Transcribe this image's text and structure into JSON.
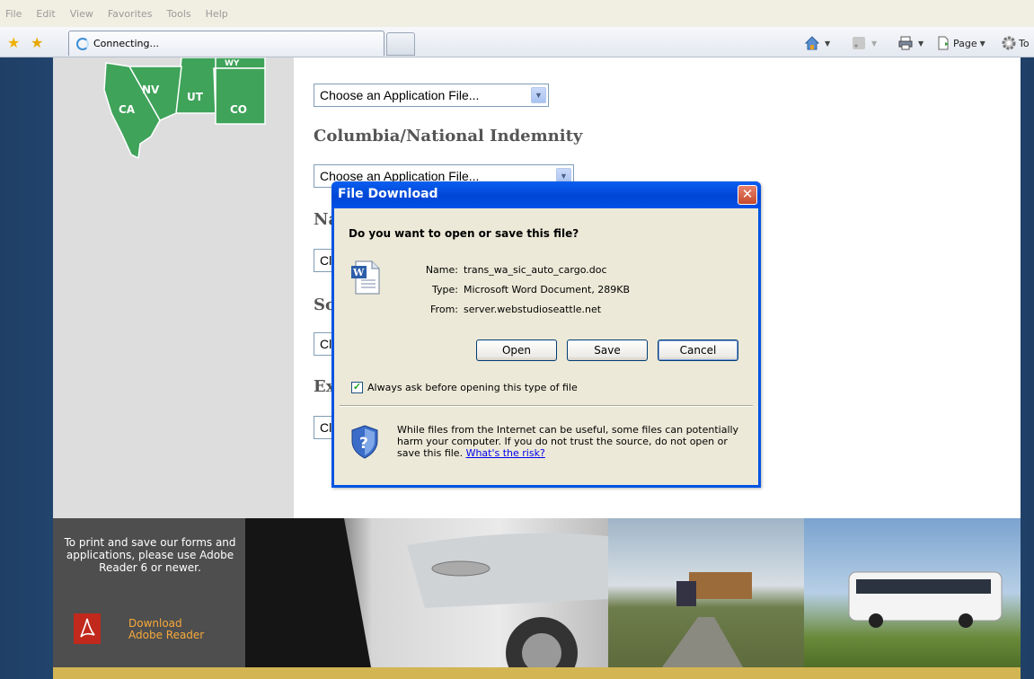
{
  "menu": [
    "File",
    "Edit",
    "View",
    "Favorites",
    "Tools",
    "Help"
  ],
  "tab": {
    "title": "Connecting..."
  },
  "commands": {
    "page": "Page",
    "tools": "To"
  },
  "map": {
    "states": [
      "NV",
      "UT",
      "CA",
      "CO",
      "WY"
    ]
  },
  "content": {
    "select_text": "Choose an Application File...",
    "heading_columbia": "Columbia/National Indemnity",
    "partial_headings": [
      "Na",
      "So",
      "Ex"
    ],
    "partial_select": "Cl"
  },
  "dialog": {
    "title": "File Download",
    "question": "Do you want to open or save this file?",
    "fields": [
      {
        "label": "Name:",
        "value": "trans_wa_sic_auto_cargo.doc"
      },
      {
        "label": "Type:",
        "value": "Microsoft Word Document, 289KB"
      },
      {
        "label": "From:",
        "value": "server.webstudioseattle.net"
      }
    ],
    "buttons": {
      "open": "Open",
      "save": "Save",
      "cancel": "Cancel"
    },
    "checkbox": "Always ask before opening this type of file",
    "warning": "While files from the Internet can be useful, some files can potentially harm your computer. If you do not trust the source, do not open or save this file.",
    "risk_link": "What's the risk?"
  },
  "banner": {
    "message": "To print and save our forms and applications, please use Adobe Reader 6 or newer.",
    "download_line1": "Download",
    "download_line2": "Adobe Reader"
  }
}
